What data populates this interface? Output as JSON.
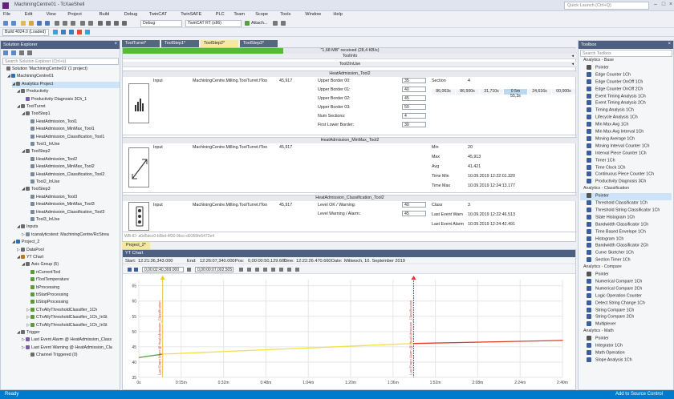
{
  "window": {
    "title": "MachiningCentre01 - TcXaeShell",
    "quick_launch": "Quick Launch (Ctrl+Q)"
  },
  "menu": [
    "File",
    "Edit",
    "View",
    "Project",
    "Build",
    "Debug",
    "TwinCAT",
    "TwinSAFE",
    "PLC",
    "Team",
    "Scope",
    "Tools",
    "Window",
    "Help"
  ],
  "toolbar": {
    "config": "Debug",
    "platform": "TwinCAT RT (x86)",
    "attach": "Attach...",
    "build": "Build 4024.0 (Loaded)"
  },
  "solution_explorer": {
    "title": "Solution Explorer",
    "search": "Search Solution Explorer (Ctrl+ü)",
    "items": [
      {
        "t": "Solution 'MachiningCentre01' (1 project)",
        "l": 0,
        "c": "#6c6c6c",
        "a": ""
      },
      {
        "t": "MachiningCentre01",
        "l": 1,
        "c": "#2c6fbc",
        "a": "◢"
      },
      {
        "t": "Analytics Project",
        "l": 2,
        "c": "#6c6c6c",
        "a": "◢",
        "sel": true
      },
      {
        "t": "Productivity",
        "l": 3,
        "c": "#6c6c6c",
        "a": "◢"
      },
      {
        "t": "Productivity Diagnosis 3Ch_1",
        "l": 4,
        "c": "#7a5ca8",
        "a": ""
      },
      {
        "t": "ToolTurret",
        "l": 3,
        "c": "#6c6c6c",
        "a": "◢"
      },
      {
        "t": "ToolStep1",
        "l": 4,
        "c": "#6c6c6c",
        "a": "◢"
      },
      {
        "t": "HeatAdmission_Tool1",
        "l": 5,
        "c": "#7a8a9a",
        "a": ""
      },
      {
        "t": "HeatAdmission_MinMax_Tool1",
        "l": 5,
        "c": "#7a8a9a",
        "a": ""
      },
      {
        "t": "HeatAdmission_Classification_Tool1",
        "l": 5,
        "c": "#7a8a9a",
        "a": ""
      },
      {
        "t": "Tool1_InUse",
        "l": 5,
        "c": "#7a8a9a",
        "a": ""
      },
      {
        "t": "ToolStep2",
        "l": 4,
        "c": "#6c6c6c",
        "a": "◢"
      },
      {
        "t": "HeatAdmission_Tool2",
        "l": 5,
        "c": "#7a8a9a",
        "a": ""
      },
      {
        "t": "HeatAdmission_MinMax_Tool2",
        "l": 5,
        "c": "#7a8a9a",
        "a": ""
      },
      {
        "t": "HeatAdmission_Classification_Tool2",
        "l": 5,
        "c": "#7a8a9a",
        "a": ""
      },
      {
        "t": "Tool2_InUse",
        "l": 5,
        "c": "#7a8a9a",
        "a": ""
      },
      {
        "t": "ToolStep3",
        "l": 4,
        "c": "#6c6c6c",
        "a": "◢"
      },
      {
        "t": "HeatAdmission_Tool3",
        "l": 5,
        "c": "#7a8a9a",
        "a": ""
      },
      {
        "t": "HeatAdmission_MinMax_Tool3",
        "l": 5,
        "c": "#7a8a9a",
        "a": ""
      },
      {
        "t": "HeatAdmission_Classification_Tool3",
        "l": 5,
        "c": "#7a8a9a",
        "a": ""
      },
      {
        "t": "Tool3_InUse",
        "l": 5,
        "c": "#7a8a9a",
        "a": ""
      },
      {
        "t": "Inputs",
        "l": 3,
        "c": "#6c6c6c",
        "a": "◢"
      },
      {
        "t": "tcanalyticstest: MachiningCentre/RcStrea",
        "l": 4,
        "c": "#7a8a9a",
        "a": "▷"
      },
      {
        "t": "Project_2",
        "l": 2,
        "c": "#2c6fbc",
        "a": "◢"
      },
      {
        "t": "DataPool",
        "l": 3,
        "c": "#6c6c6c",
        "a": "▷"
      },
      {
        "t": "YT Chart",
        "l": 3,
        "c": "#c07820",
        "a": "◢"
      },
      {
        "t": "Axis Group (5)",
        "l": 4,
        "c": "#6c6c6c",
        "a": "◢"
      },
      {
        "t": "nCurrentTool",
        "l": 5,
        "c": "#5a9a3a",
        "a": ""
      },
      {
        "t": "fToolTemperature",
        "l": 5,
        "c": "#5a9a3a",
        "a": ""
      },
      {
        "t": "bProcessing",
        "l": 5,
        "c": "#5a9a3a",
        "a": ""
      },
      {
        "t": "bStartProcessing",
        "l": 5,
        "c": "#5a9a3a",
        "a": ""
      },
      {
        "t": "bStopProcessing",
        "l": 5,
        "c": "#5a9a3a",
        "a": ""
      },
      {
        "t": "CTxAllyThresholdClassifier_1Ch",
        "l": 5,
        "c": "#5a9a3a",
        "a": "▷"
      },
      {
        "t": "CTxAllyThresholdClassifier_1Ch_InSt",
        "l": 5,
        "c": "#5a9a3a",
        "a": "▷"
      },
      {
        "t": "CTxAllyThresholdClassifier_1Ch_InSt",
        "l": 5,
        "c": "#5a9a3a",
        "a": "▷"
      },
      {
        "t": "Trigger",
        "l": 3,
        "c": "#6c6c6c",
        "a": "◢"
      },
      {
        "t": "Last Event Alarm @ HeatAdmission_Class",
        "l": 4,
        "c": "#7a5ca8",
        "a": "▷"
      },
      {
        "t": "Last Event Warning @ HeatAdmission_Cla",
        "l": 4,
        "c": "#7a5ca8",
        "a": "▷"
      },
      {
        "t": "Channel Triggered (0)",
        "l": 5,
        "c": "#6c6c6c",
        "a": ""
      }
    ]
  },
  "tabs": [
    {
      "label": "ToolTurret*",
      "active": false
    },
    {
      "label": "ToolStep1*",
      "active": false
    },
    {
      "label": "ToolStep2*",
      "active": true
    },
    {
      "label": "ToolStep3*",
      "active": false
    }
  ],
  "doc": {
    "progress": "\"1,68 MB\" received (28,4 KB/s)",
    "tool_info": "ToolInfo",
    "tool_in_use": "Tool2InUse",
    "blocks": [
      {
        "header": "HeatAdmission_Tool2",
        "input": "Input",
        "path": "MachiningCentre.Milling.ToolTurret.fToo",
        "value": "45,917",
        "params": [
          {
            "l": "Upper Border 00:",
            "v": "35"
          },
          {
            "l": "Upper Border 01:",
            "v": "40"
          },
          {
            "l": "Upper Border 02:",
            "v": "45"
          },
          {
            "l": "Upper Border 03:",
            "v": "50"
          },
          {
            "l": "Num Sections:",
            "v": "4"
          },
          {
            "l": "First Lower Border:",
            "v": "30"
          }
        ],
        "section_label": "Section",
        "section_value": "4",
        "sections": [
          "86,063s",
          "86,500s",
          "31,710s",
          "0 5m 55,3s",
          "24,616s",
          "00,000s"
        ]
      },
      {
        "header": "HeatAdmission_MinMax_Tool2",
        "input": "Input",
        "path": "MachiningCentre.Milling.ToolTurret.fToo",
        "value": "45,917",
        "stats": [
          {
            "l": "Min",
            "v": "20"
          },
          {
            "l": "Max",
            "v": "45,913"
          },
          {
            "l": "Avg",
            "v": "41,421"
          },
          {
            "l": "Time Min",
            "v": "10.09.2019 12:22:01.320"
          },
          {
            "l": "Time Max",
            "v": "10.09.2019 12:24:13.177"
          }
        ]
      },
      {
        "header": "HeatAdmission_Classification_Tool2",
        "input": "Input",
        "path": "MachiningCentre.Milling.ToolTurret.fToo",
        "value": "45,917",
        "params": [
          {
            "l": "Level OK / Warning:",
            "v": "40"
          },
          {
            "l": "Level Warning / Alarm:",
            "v": "45"
          }
        ],
        "stats": [
          {
            "l": "Class",
            "v": "3"
          },
          {
            "l": "Last Event Warn",
            "v": "10.09.2019 12:22:46.513"
          },
          {
            "l": "Last Event Alarm",
            "v": "10.09.2019 12:24:42.491"
          }
        ]
      }
    ],
    "footer": "WB-ID: a0d5dcc0-b5bd-4f30-9bcc-d9355fe5472e4"
  },
  "chart_window": {
    "tab": "Project_2*",
    "title": "YT Chart",
    "info": [
      {
        "l": "Start:",
        "v": "12:21:36,343.000"
      },
      {
        "l": "End:",
        "v": "12:26:07,340.000"
      },
      {
        "l": "Pos:",
        "v": "0,00:00:50,129.660"
      },
      {
        "l": "Time:",
        "v": "12:22:26.470.660"
      },
      {
        "l": "Date:",
        "v": "Mittwoch, 10. September 2019"
      }
    ],
    "time_box": "0,00:02:40,399.000",
    "pos_box": "0,00:00:07,002.505"
  },
  "chart_data": {
    "type": "line",
    "yticks": [
      35,
      40,
      45,
      50,
      55,
      60,
      65
    ],
    "xticks": [
      "0s",
      "0:15m",
      "0:32m",
      "0:48m",
      "1:04m",
      "1:20m",
      "1:36m",
      "1:52m",
      "2:08m",
      "2:24m",
      "2:40m"
    ],
    "ylim": [
      35,
      67
    ],
    "series": [
      {
        "color": "#4aa03a",
        "x": [
          0,
          0.15
        ],
        "y": [
          41.5,
          42.6
        ]
      },
      {
        "color": "#f3e04a",
        "x": [
          0.15,
          1.73
        ],
        "y": [
          42.6,
          46.1
        ]
      },
      {
        "color": "#e23a2a",
        "x": [
          1.73,
          2.67
        ],
        "y": [
          46.1,
          47.1
        ]
      }
    ],
    "markers": [
      {
        "x": 0.15,
        "label": "Last Event Warn @ HeatAdmission_Classification"
      },
      {
        "x": 1.73,
        "label": "Last Event Alarm @ HeatAdmission_Classification"
      }
    ]
  },
  "toolbox": {
    "title": "Toolbox",
    "search": "Search Toolbox",
    "items": [
      {
        "g": "Analytics - Base"
      },
      {
        "t": "Pointer",
        "c": "#555"
      },
      {
        "t": "Edge Counter 1Ch",
        "c": "#3d5e9e"
      },
      {
        "t": "Edge Counter OnOff 1Ch",
        "c": "#3d5e9e"
      },
      {
        "t": "Edge Counter OnOff 2Ch",
        "c": "#3d5e9e"
      },
      {
        "t": "Event Timing Analysis 1Ch",
        "c": "#3d5e9e"
      },
      {
        "t": "Event Timing Analysis 2Ch",
        "c": "#3d5e9e"
      },
      {
        "t": "Timing Analysis 1Ch",
        "c": "#3d5e9e"
      },
      {
        "t": "Lifecycle Analysis 1Ch",
        "c": "#3d5e9e"
      },
      {
        "t": "Min Max Avg 1Ch",
        "c": "#3d5e9e"
      },
      {
        "t": "Min Max Avg Interval 1Ch",
        "c": "#3d5e9e"
      },
      {
        "t": "Moving Average 1Ch",
        "c": "#3d5e9e"
      },
      {
        "t": "Moving Interval Counter 1Ch",
        "c": "#3d5e9e"
      },
      {
        "t": "Interval Piece Counter 1Ch",
        "c": "#3d5e9e"
      },
      {
        "t": "Timer 1Ch",
        "c": "#3d5e9e"
      },
      {
        "t": "Time Clock 1Ch",
        "c": "#3d5e9e"
      },
      {
        "t": "Continuous Piece Counter 1Ch",
        "c": "#3d5e9e"
      },
      {
        "t": "Productivity Diagnosis 3Ch",
        "c": "#3d5e9e"
      },
      {
        "g": "Analytics - Classification"
      },
      {
        "t": "Pointer",
        "c": "#555",
        "sel": true
      },
      {
        "t": "Threshold Classificator 1Ch",
        "c": "#3d5e9e"
      },
      {
        "t": "Threshold String Classificator 1Ch",
        "c": "#3d5e9e"
      },
      {
        "t": "State Histogram 1Ch",
        "c": "#3d5e9e"
      },
      {
        "t": "Bandwidth Classificator 1Ch",
        "c": "#3d5e9e"
      },
      {
        "t": "Time Based Envelope 1Ch",
        "c": "#3d5e9e"
      },
      {
        "t": "Histogram 1Ch",
        "c": "#3d5e9e"
      },
      {
        "t": "Bandwidth Classificator 2Ch",
        "c": "#3d5e9e"
      },
      {
        "t": "Curve Sketcher 1Ch",
        "c": "#3d5e9e"
      },
      {
        "t": "Section Timer 1Ch",
        "c": "#3d5e9e"
      },
      {
        "g": "Analytics - Compare"
      },
      {
        "t": "Pointer",
        "c": "#555"
      },
      {
        "t": "Numerical Compare 1Ch",
        "c": "#3d5e9e"
      },
      {
        "t": "Numerical Compare 2Ch",
        "c": "#3d5e9e"
      },
      {
        "t": "Logic Operation Counter",
        "c": "#3d5e9e"
      },
      {
        "t": "Detect String Change 1Ch",
        "c": "#3d5e9e"
      },
      {
        "t": "String Compare 1Ch",
        "c": "#3d5e9e"
      },
      {
        "t": "String Compare 2Ch",
        "c": "#3d5e9e"
      },
      {
        "t": "Multiplexer",
        "c": "#3d5e9e"
      },
      {
        "g": "Analytics - Math"
      },
      {
        "t": "Pointer",
        "c": "#555"
      },
      {
        "t": "Integrator 1Ch",
        "c": "#3d5e9e"
      },
      {
        "t": "Math Operation",
        "c": "#3d5e9e"
      },
      {
        "t": "Slope Analysis 1Ch",
        "c": "#3d5e9e"
      }
    ]
  },
  "status": {
    "left": "Ready",
    "right": "Add to Source Control"
  }
}
